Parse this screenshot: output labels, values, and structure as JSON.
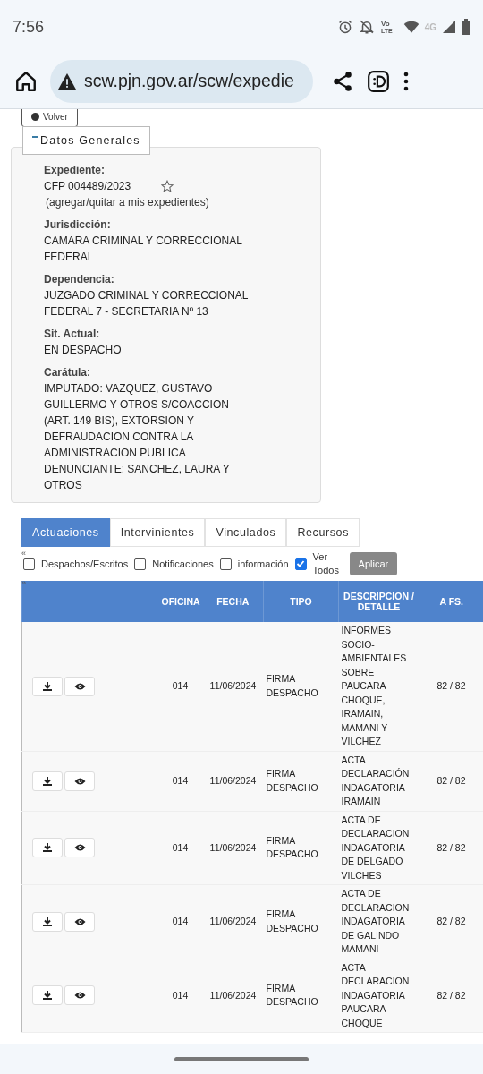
{
  "status_bar": {
    "time": "7:56",
    "network": "4G",
    "volte": [
      "Vo",
      "LTE"
    ]
  },
  "browser": {
    "url": "scw.pjn.gov.ar/scw/expedie"
  },
  "back_button": "Volver",
  "panel": {
    "title": "Datos Generales",
    "expanded": true,
    "fields": [
      {
        "label": "Expediente:",
        "value": "CFP 004489/2023",
        "starred": false,
        "note": "(agregar/quitar a mis expedientes)"
      },
      {
        "label": "Jurisdicción:",
        "value": "CAMARA CRIMINAL Y CORRECCIONAL FEDERAL"
      },
      {
        "label": "Dependencia:",
        "value": "JUZGADO CRIMINAL Y CORRECCIONAL FEDERAL 7 - SECRETARIA Nº 13"
      },
      {
        "label": "Sit. Actual:",
        "value": "EN DESPACHO"
      },
      {
        "label": "Carátula:",
        "value": "IMPUTADO: VAZQUEZ, GUSTAVO GUILLERMO Y OTROS S/COACCION (ART. 149 BIS), EXTORSION Y DEFRAUDACION CONTRA LA ADMINISTRACION PUBLICA DENUNCIANTE: SANCHEZ, LAURA Y OTROS"
      }
    ]
  },
  "tabs": [
    {
      "label": "Actuaciones",
      "selected": true
    },
    {
      "label": "Intervinientes",
      "selected": false
    },
    {
      "label": "Vinculados",
      "selected": false
    },
    {
      "label": "Recursos",
      "selected": false
    }
  ],
  "filters": [
    {
      "label": "Despachos/Escritos",
      "checked": false
    },
    {
      "label": "Notificaciones",
      "checked": false
    },
    {
      "label": "información",
      "checked": false
    },
    {
      "label": "Ver Todos",
      "checked": true
    }
  ],
  "apply_button": "Aplicar",
  "pager": {
    "prev": "«",
    "next": "»"
  },
  "table": {
    "columns": [
      "OFICINA",
      "FECHA",
      "TIPO",
      "DESCRIPCION / DETALLE",
      "A FS."
    ],
    "rows": [
      {
        "oficina": "014",
        "fecha": "11/06/2024",
        "tipo": "FIRMA DESPACHO",
        "descripcion": "INFORMES SOCIO-AMBIENTALES SOBRE PAUCARA CHOQUE, IRAMAIN, MAMANI Y VILCHEZ",
        "a_fs": "82 / 82"
      },
      {
        "oficina": "014",
        "fecha": "11/06/2024",
        "tipo": "FIRMA DESPACHO",
        "descripcion": "ACTA DECLARACIÓN INDAGATORIA IRAMAIN",
        "a_fs": "82 / 82"
      },
      {
        "oficina": "014",
        "fecha": "11/06/2024",
        "tipo": "FIRMA DESPACHO",
        "descripcion": "ACTA DE DECLARACION INDAGATORIA DE DELGADO VILCHES",
        "a_fs": "82 / 82"
      },
      {
        "oficina": "014",
        "fecha": "11/06/2024",
        "tipo": "FIRMA DESPACHO",
        "descripcion": "ACTA DE DECLARACION INDAGATORIA DE GALINDO MAMANI",
        "a_fs": "82 / 82"
      },
      {
        "oficina": "014",
        "fecha": "11/06/2024",
        "tipo": "FIRMA DESPACHO",
        "descripcion": "ACTA DECLARACION INDAGATORIA PAUCARA CHOQUE",
        "a_fs": "82 / 82"
      }
    ]
  }
}
